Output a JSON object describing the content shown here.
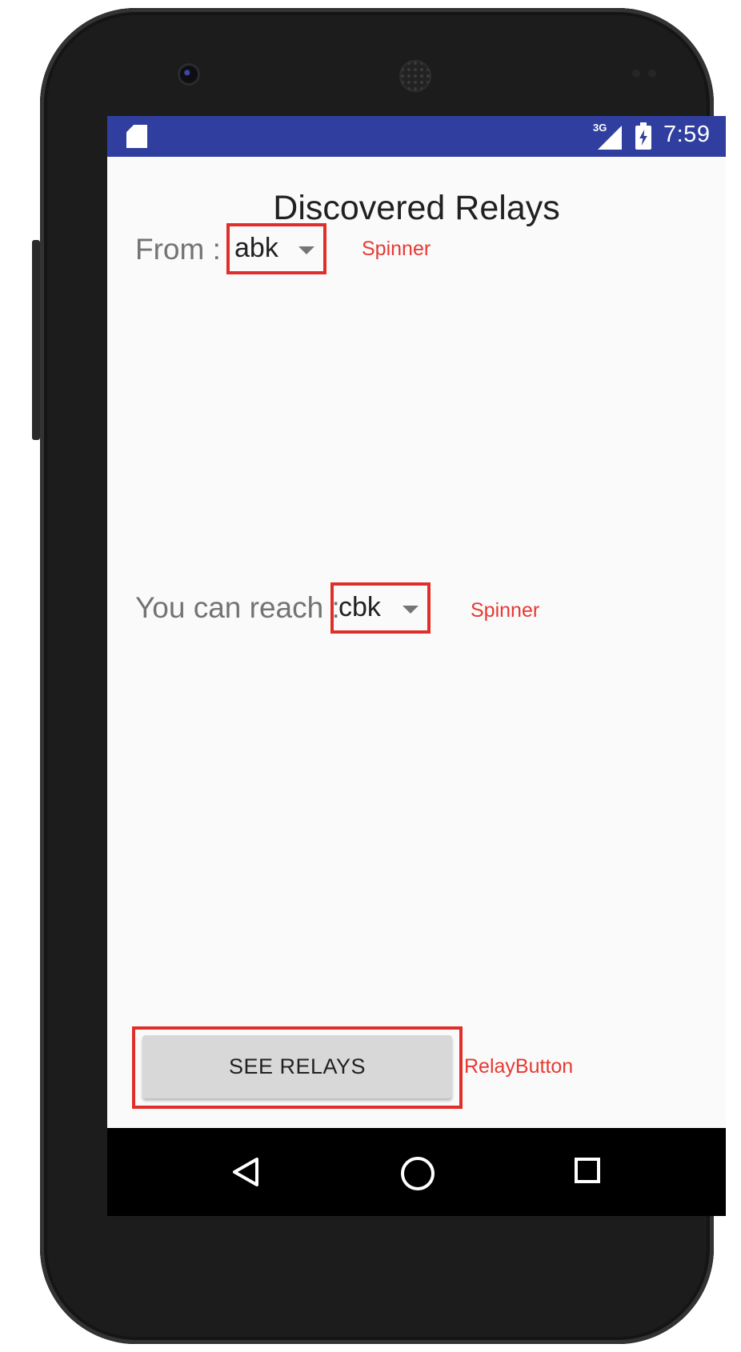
{
  "status_bar": {
    "network": "3G",
    "time": "7:59",
    "icons": [
      "sd-card-icon",
      "signal-icon",
      "battery-charging-icon"
    ]
  },
  "page": {
    "title": "Discovered Relays"
  },
  "from_field": {
    "label": "From :",
    "selected_value": "abk",
    "annotation": "Spinner"
  },
  "reach_field": {
    "label": "You can reach :",
    "selected_value": "cbk",
    "annotation": "Spinner"
  },
  "relay_button": {
    "label": "SEE RELAYS",
    "annotation": "RelayButton"
  },
  "nav_bar": {
    "icons": [
      "back-icon",
      "home-icon",
      "recents-icon"
    ]
  },
  "colors": {
    "status_bar": "#303f9f",
    "annotation_red": "#e02f2a",
    "background": "#fafafa",
    "button": "#d7d8d7"
  }
}
